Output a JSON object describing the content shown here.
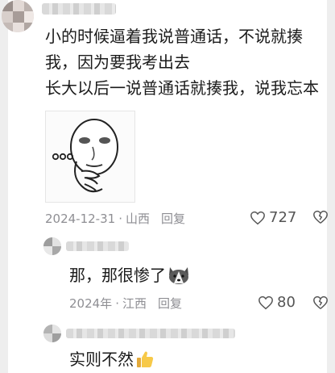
{
  "comments": [
    {
      "lines": [
        "小的时候逼着我说普通话，不说就揍",
        "我，因为要我考出去",
        "长大以后一说普通话就揍我，说我忘本"
      ],
      "date": "2024-12-31",
      "location": "山西",
      "reply_label": "回复",
      "likes": "727",
      "sticker": "thinking-face-meme-sticker"
    },
    {
      "text": "那，那很惨了",
      "emoji": "husky-dog-face-emoji",
      "date": "2024年",
      "location": "江西",
      "reply_label": "回复",
      "likes": "80"
    },
    {
      "text": "实则不然",
      "emoji": "thumbs-up-emoji"
    }
  ],
  "meta_separator": "·"
}
